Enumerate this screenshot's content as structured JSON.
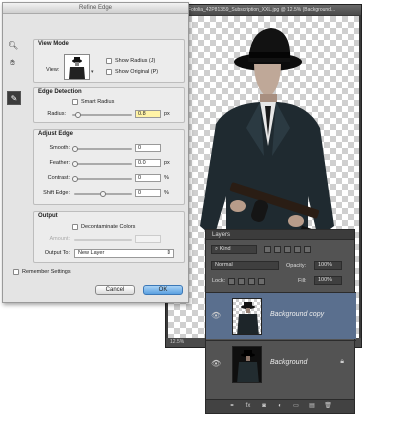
{
  "document": {
    "title": "Fotolia_42P81359_Subscription_XXL.jpg @ 12.5% (Background...",
    "status": "12.5%"
  },
  "dialog": {
    "title": "Refine Edge",
    "view_mode": {
      "title": "View Mode",
      "view_label": "View:",
      "show_radius": "Show Radius (J)",
      "show_original": "Show Original (P)"
    },
    "edge_detection": {
      "title": "Edge Detection",
      "smart_radius": "Smart Radius",
      "radius_label": "Radius:",
      "radius_value": "0.8",
      "radius_unit": "px",
      "radius_level": 0.1
    },
    "adjust_edge": {
      "title": "Adjust Edge",
      "smooth_label": "Smooth:",
      "smooth_value": "0",
      "feather_label": "Feather:",
      "feather_value": "0.0",
      "feather_unit": "px",
      "contrast_label": "Contrast:",
      "contrast_value": "0",
      "contrast_unit": "%",
      "shift_label": "Shift Edge:",
      "shift_value": "0",
      "shift_unit": "%"
    },
    "output": {
      "title": "Output",
      "decontaminate": "Decontaminate Colors",
      "amount_label": "Amount:",
      "output_to_label": "Output To:",
      "output_to_value": "New Layer"
    },
    "remember": "Remember Settings",
    "cancel": "Cancel",
    "ok": "OK"
  },
  "layers": {
    "title": "Layers",
    "kind": "Kind",
    "blend_mode": "Normal",
    "opacity_label": "Opacity:",
    "opacity_value": "100%",
    "lock_label": "Lock:",
    "fill_label": "Fill:",
    "fill_value": "100%",
    "items": [
      {
        "name": "Background copy"
      },
      {
        "name": "Background"
      }
    ],
    "bottom_icons": [
      "⚭",
      "fx",
      "◙",
      "◐",
      "▭",
      "▤",
      "🗑"
    ]
  },
  "colors": {
    "selection": "#5a6f8e",
    "ok_blue": "#5aa0e0",
    "highlight_value": "#fff3a6"
  }
}
